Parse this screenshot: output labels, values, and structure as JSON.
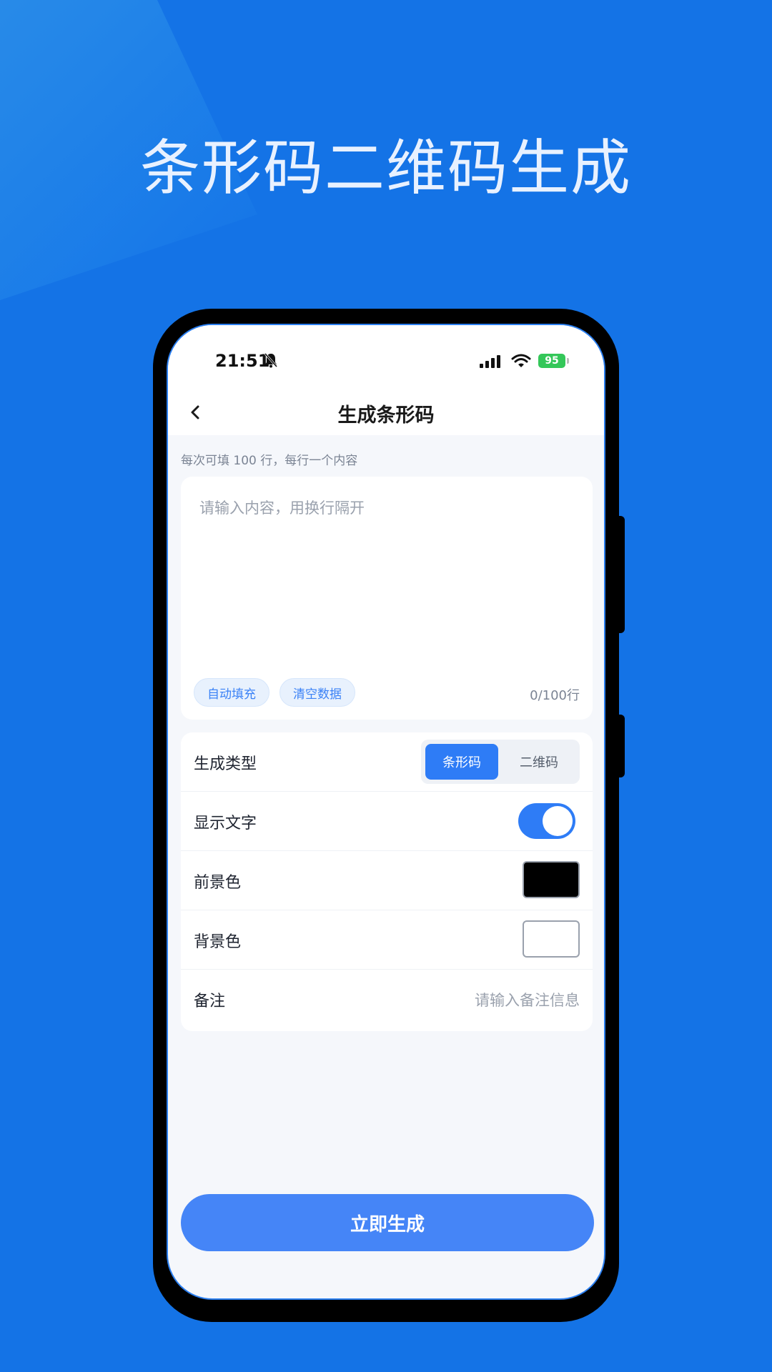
{
  "promo": {
    "title": "条形码二维码生成"
  },
  "status_bar": {
    "time": "21:51",
    "battery": "95"
  },
  "nav": {
    "title": "生成条形码",
    "back_icon": "chevron-left-icon"
  },
  "input_section": {
    "hint": "每次可填 100 行，每行一个内容",
    "placeholder": "请输入内容，用换行隔开",
    "auto_fill_label": "自动填充",
    "clear_label": "清空数据",
    "counter": "0/100行"
  },
  "settings": {
    "type_label": "生成类型",
    "type_options": [
      "条形码",
      "二维码"
    ],
    "type_selected": "条形码",
    "show_text_label": "显示文字",
    "show_text_on": true,
    "foreground_label": "前景色",
    "foreground_color": "#000000",
    "background_label": "背景色",
    "background_color": "#ffffff",
    "note_label": "备注",
    "note_placeholder": "请输入备注信息"
  },
  "actions": {
    "generate_label": "立即生成"
  },
  "colors": {
    "accent": "#2e7cf6",
    "page_bg": "#1473e6"
  }
}
